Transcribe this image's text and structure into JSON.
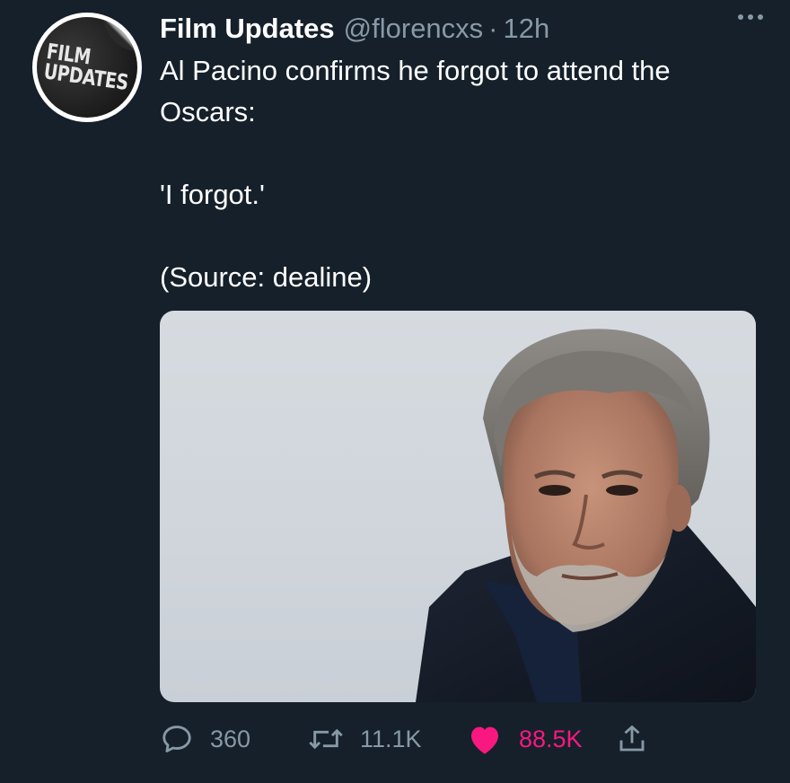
{
  "tweet": {
    "author_name": "Film Updates",
    "handle": "@florencxs",
    "separator": "·",
    "time": "12h",
    "avatar_text": [
      "FILM",
      "UPDATES"
    ],
    "text_lines": [
      "Al Pacino confirms he forgot to attend the",
      "Oscars:",
      "",
      "'I forgot.'",
      "",
      "(Source: dealine)"
    ]
  },
  "media": {
    "icon": "photo-of-man-with-grey-hair-and-beard"
  },
  "actions": {
    "replies": "360",
    "retweets": "11.1K",
    "likes": "88.5K"
  },
  "colors": {
    "background": "#15202b",
    "secondary_text": "#8899a6",
    "like": "#f91880"
  }
}
